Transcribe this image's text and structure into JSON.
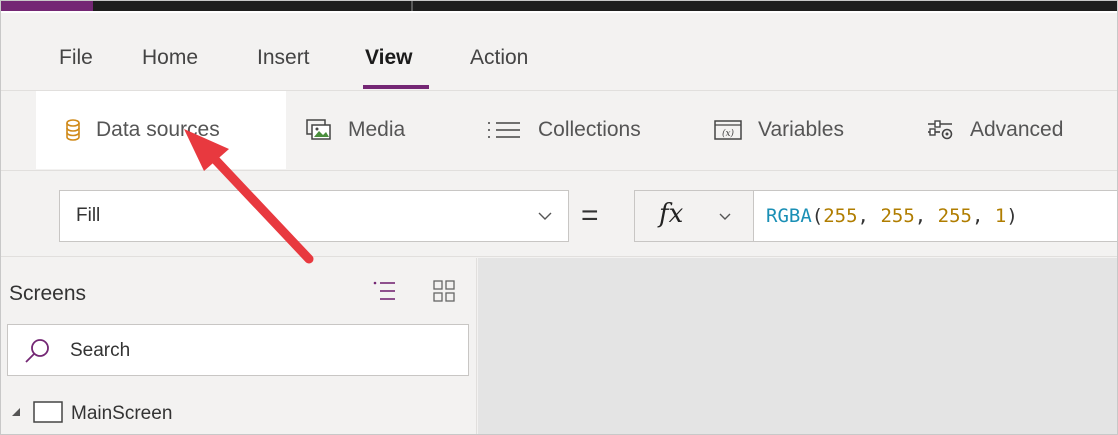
{
  "menu": {
    "tabs": [
      {
        "label": "File"
      },
      {
        "label": "Home"
      },
      {
        "label": "Insert"
      },
      {
        "label": "View"
      },
      {
        "label": "Action"
      }
    ],
    "active_tab": "View"
  },
  "ribbon": {
    "buttons": [
      {
        "label": "Data sources",
        "icon": "database-icon"
      },
      {
        "label": "Media",
        "icon": "media-icon"
      },
      {
        "label": "Collections",
        "icon": "list-icon"
      },
      {
        "label": "Variables",
        "icon": "variable-icon"
      },
      {
        "label": "Advanced",
        "icon": "sliders-icon"
      }
    ],
    "selected": "Data sources"
  },
  "formula_bar": {
    "property": "Fill",
    "equals": "=",
    "fx_label": "fx",
    "expression": {
      "fn": "RGBA",
      "open": "(",
      "a": "255",
      "sep1": ", ",
      "b": "255",
      "sep2": ", ",
      "c": "255",
      "sep3": ", ",
      "d": "1",
      "close": ")"
    }
  },
  "screens_panel": {
    "title": "Screens",
    "search_placeholder": "Search",
    "items": [
      {
        "label": "MainScreen"
      }
    ]
  },
  "colors": {
    "accent": "#742774",
    "arrow": "#e8393f",
    "function": "#1a8fb5",
    "number": "#b07d00"
  }
}
